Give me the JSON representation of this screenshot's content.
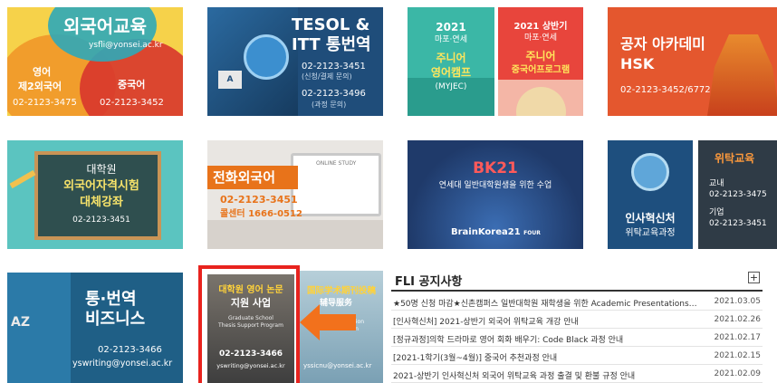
{
  "tiles": {
    "foreign_lang": {
      "title": "외국어교육",
      "email": "ysfli@yonsei.ac.kr",
      "eng": "영어",
      "second": "제2외국어",
      "phone_left": "02-2123-3475",
      "chinese": "중국어",
      "phone_right": "02-2123-3452"
    },
    "tesol": {
      "title1": "TESOL &",
      "title2": "ITT 통번역",
      "phone1": "02-2123-3451",
      "note1": "(신청/결제 문의)",
      "phone2": "02-2123-3496",
      "note2": "(과정 문의)"
    },
    "junior_camp": {
      "year": "2021",
      "sub": "마포·연세",
      "title1": "주니어",
      "title2": "영어캠프",
      "abbr": "(MYJEC)"
    },
    "junior_china": {
      "year": "2021 상반기",
      "sub": "마포·연세",
      "title1": "주니어",
      "title2": "중국어프로그램"
    },
    "hsk": {
      "title1": "공자 아카데미",
      "title2": "HSK",
      "phone": "02-2123-3452/6772"
    },
    "grad_exam": {
      "line1": "대학원",
      "line2": "외국어자격시험",
      "line3": "대체강좌",
      "phone": "02-2123-3451"
    },
    "phone_lang": {
      "title": "전화외국어",
      "phone": "02-2123-3451",
      "center": "콜센터 1666-0512",
      "screen": "ONLINE STUDY"
    },
    "bk21": {
      "title": "BK21",
      "desc": "연세대 일반대학원생을 위한 수업",
      "logo": "BrainKorea21",
      "logo_suffix": "FOUR"
    },
    "hr": {
      "line1": "인사혁신처",
      "line2": "위탁교육과정"
    },
    "consign": {
      "title": "위탁교육",
      "in_label": "교내",
      "in_phone": "02-2123-3475",
      "corp_label": "기업",
      "corp_phone": "02-2123-3451"
    },
    "translation": {
      "line1": "통·번역",
      "line2": "비즈니스",
      "phone": "02-2123-3466",
      "email": "yswriting@yonsei.ac.kr",
      "az": "AZ"
    },
    "grad_english": {
      "line1": "대학원 영어 논문",
      "line2": "지원 사업",
      "eng1": "Graduate School",
      "eng2": "Thesis Support Program",
      "phone": "02-2123-3466",
      "email": "yswriting@yonsei.ac.kr"
    },
    "intl_journal": {
      "line1": "国际学术期刊投稿",
      "line2": "辅导服务",
      "eng1": "...aration",
      "eng2": "...ation",
      "email": "yssicnu@yonsei.ac.kr"
    }
  },
  "notice": {
    "title": "FLI 공지사항",
    "more": "+",
    "items": [
      {
        "text": "★50명 신청 마감★신촌캠퍼스 일반대학원 재학생을 위한 Academic Presentations…",
        "date": "2021.03.05"
      },
      {
        "text": "[인사혁신처] 2021-상반기 외국어 위탁교육 개강 안내",
        "date": "2021.02.26"
      },
      {
        "text": "[정규과정]의학 드라마로 영어 회화 배우기: Code Black 과정 안내",
        "date": "2021.02.17"
      },
      {
        "text": "[2021-1학기(3월~4월)] 중국어 추천과정 안내",
        "date": "2021.02.15"
      },
      {
        "text": "2021-상반기 인사혁신처 외국어 위탁교육 과정 출결 및 환불 규정 안내",
        "date": "2021.02.09"
      }
    ]
  },
  "colors": {
    "highlight": "#e8231e",
    "arrow": "#f2711c"
  }
}
